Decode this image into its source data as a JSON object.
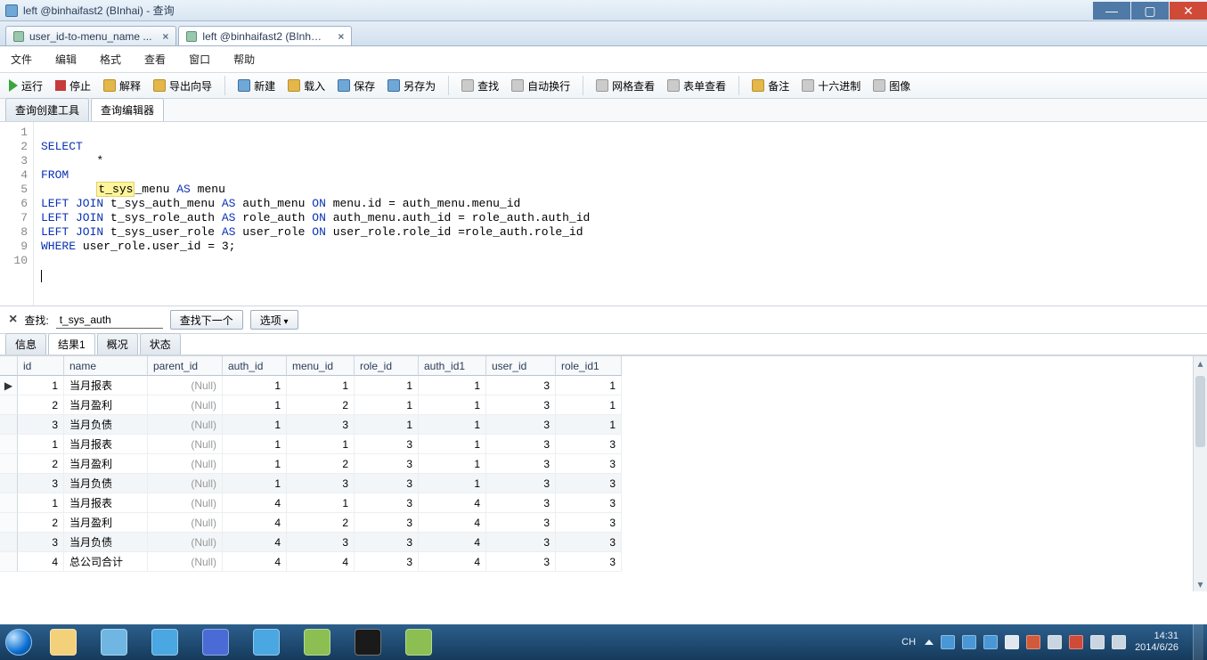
{
  "window": {
    "title": "left @binhaifast2 (BInhai) - 查询"
  },
  "tabs": [
    {
      "label": "user_id-to-menu_name ...",
      "active": false
    },
    {
      "label": "left @binhaifast2 (BInhai...",
      "active": true
    }
  ],
  "menus": [
    "文件",
    "编辑",
    "格式",
    "查看",
    "窗口",
    "帮助"
  ],
  "toolbar": {
    "run": "运行",
    "stop": "停止",
    "explain": "解释",
    "export": "导出向导",
    "new": "新建",
    "load": "载入",
    "save": "保存",
    "saveas": "另存为",
    "find": "查找",
    "autowrap": "自动换行",
    "gridview": "网格查看",
    "formview": "表单查看",
    "notes": "备注",
    "hex": "十六进制",
    "image": "图像"
  },
  "subtabs": {
    "builder": "查询创建工具",
    "editor": "查询编辑器"
  },
  "sql": {
    "lines": [
      "1",
      "2",
      "3",
      "4",
      "5",
      "6",
      "7",
      "8",
      "9",
      "10"
    ],
    "l1a": "SELECT",
    "l2": "\t*",
    "l3a": "FROM",
    "l4_indent": "\t",
    "l4_hl": "t_sys",
    "l4_rest": "_menu ",
    "l4_as": "AS",
    "l4_alias": " menu",
    "l5_lj": "LEFT JOIN",
    "l5_mid": " t_sys_auth_menu ",
    "l5_as": "AS",
    "l5_mid2": " auth_menu ",
    "l5_on": "ON",
    "l5_end": " menu.id = auth_menu.menu_id",
    "l6_lj": "LEFT JOIN",
    "l6_mid": " t_sys_role_auth ",
    "l6_as": "AS",
    "l6_mid2": " role_auth ",
    "l6_on": "ON",
    "l6_end": " auth_menu.auth_id = role_auth.auth_id",
    "l7_lj": "LEFT JOIN",
    "l7_mid": " t_sys_user_role ",
    "l7_as": "AS",
    "l7_mid2": " user_role ",
    "l7_on": "ON",
    "l7_end": " user_role.role_id =role_auth.role_id",
    "l8_where": "WHERE",
    "l8_end": " user_role.user_id = 3;"
  },
  "findbar": {
    "label": "查找:",
    "value": "t_sys_auth",
    "findnext": "查找下一个",
    "options": "选项"
  },
  "result_tabs": {
    "info": "信息",
    "result1": "结果1",
    "profile": "概况",
    "status": "状态"
  },
  "columns": [
    "id",
    "name",
    "parent_id",
    "auth_id",
    "menu_id",
    "role_id",
    "auth_id1",
    "user_id",
    "role_id1"
  ],
  "null_text": "(Null)",
  "rows": [
    {
      "id": "1",
      "name": "当月报表",
      "parent_id": null,
      "auth_id": "1",
      "menu_id": "1",
      "role_id": "1",
      "auth_id1": "1",
      "user_id": "3",
      "role_id1": "1"
    },
    {
      "id": "2",
      "name": "当月盈利",
      "parent_id": null,
      "auth_id": "1",
      "menu_id": "2",
      "role_id": "1",
      "auth_id1": "1",
      "user_id": "3",
      "role_id1": "1"
    },
    {
      "id": "3",
      "name": "当月负债",
      "parent_id": null,
      "auth_id": "1",
      "menu_id": "3",
      "role_id": "1",
      "auth_id1": "1",
      "user_id": "3",
      "role_id1": "1"
    },
    {
      "id": "1",
      "name": "当月报表",
      "parent_id": null,
      "auth_id": "1",
      "menu_id": "1",
      "role_id": "3",
      "auth_id1": "1",
      "user_id": "3",
      "role_id1": "3"
    },
    {
      "id": "2",
      "name": "当月盈利",
      "parent_id": null,
      "auth_id": "1",
      "menu_id": "2",
      "role_id": "3",
      "auth_id1": "1",
      "user_id": "3",
      "role_id1": "3"
    },
    {
      "id": "3",
      "name": "当月负债",
      "parent_id": null,
      "auth_id": "1",
      "menu_id": "3",
      "role_id": "3",
      "auth_id1": "1",
      "user_id": "3",
      "role_id1": "3"
    },
    {
      "id": "1",
      "name": "当月报表",
      "parent_id": null,
      "auth_id": "4",
      "menu_id": "1",
      "role_id": "3",
      "auth_id1": "4",
      "user_id": "3",
      "role_id1": "3"
    },
    {
      "id": "2",
      "name": "当月盈利",
      "parent_id": null,
      "auth_id": "4",
      "menu_id": "2",
      "role_id": "3",
      "auth_id1": "4",
      "user_id": "3",
      "role_id1": "3"
    },
    {
      "id": "3",
      "name": "当月负债",
      "parent_id": null,
      "auth_id": "4",
      "menu_id": "3",
      "role_id": "3",
      "auth_id1": "4",
      "user_id": "3",
      "role_id1": "3"
    },
    {
      "id": "4",
      "name": "总公司合计",
      "parent_id": null,
      "auth_id": "4",
      "menu_id": "4",
      "role_id": "3",
      "auth_id1": "4",
      "user_id": "3",
      "role_id1": "3"
    }
  ],
  "taskbar": {
    "language": "CH",
    "time": "14:31",
    "date": "2014/6/26",
    "apps": [
      {
        "name": "explorer",
        "color": "#f3d07a"
      },
      {
        "name": "browser-globe",
        "color": "#6fb7e2"
      },
      {
        "name": "ie",
        "color": "#4aa7e2"
      },
      {
        "name": "pinwheel",
        "color": "#4a6bd6"
      },
      {
        "name": "g-app",
        "color": "#4aa7e2"
      },
      {
        "name": "leaf-app",
        "color": "#8bbf52"
      },
      {
        "name": "ps",
        "color": "#1a1a1a"
      },
      {
        "name": "round-app",
        "color": "#8bbf52"
      }
    ],
    "tray_icons": [
      {
        "name": "chevron-up",
        "color": "transparent"
      },
      {
        "name": "ime-icon",
        "color": "#4a97d6"
      },
      {
        "name": "keyboard-icon",
        "color": "#4a97d6"
      },
      {
        "name": "help-icon",
        "color": "#4a97d6"
      },
      {
        "name": "flag-icon",
        "color": "#e0e7ee"
      },
      {
        "name": "av-icon",
        "color": "#d05a3a"
      },
      {
        "name": "net-icon",
        "color": "#c9d6e1"
      },
      {
        "name": "u-icon",
        "color": "#d04a38"
      },
      {
        "name": "wifi-icon",
        "color": "#c9d6e1"
      },
      {
        "name": "vol-icon",
        "color": "#c9d6e1"
      }
    ]
  }
}
